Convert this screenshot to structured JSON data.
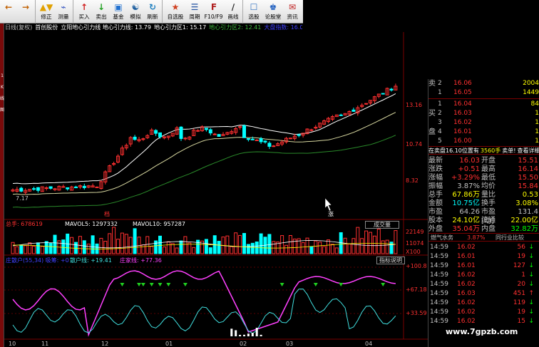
{
  "toolbar": {
    "buttons": [
      {
        "name": "back",
        "label": "",
        "icon": "←",
        "color": "#c06000"
      },
      {
        "name": "forward",
        "label": "",
        "icon": "→",
        "color": "#c06000"
      },
      {
        "name": "modify",
        "label": "修正",
        "icon": "▲▼",
        "color": "#e0a000"
      },
      {
        "name": "measure",
        "label": "测量",
        "icon": "⌁",
        "color": "#3050c0"
      },
      {
        "name": "buy",
        "label": "买入",
        "icon": "↑",
        "color": "#d02020"
      },
      {
        "name": "sell",
        "label": "卖出",
        "icon": "↓",
        "color": "#20a020"
      },
      {
        "name": "fund",
        "label": "基金",
        "icon": "▣",
        "color": "#2070d0"
      },
      {
        "name": "simulate",
        "label": "模拟",
        "icon": "☯",
        "color": "#2060a0"
      },
      {
        "name": "refresh",
        "label": "刷新",
        "icon": "↻",
        "color": "#2080c0"
      },
      {
        "name": "watchlist",
        "label": "自选股",
        "icon": "★",
        "color": "#d04020"
      },
      {
        "name": "periodic",
        "label": "周期",
        "icon": "☰",
        "color": "#2050a0"
      },
      {
        "name": "f10",
        "label": "F10/F9",
        "icon": "F",
        "color": "#b02020"
      },
      {
        "name": "draw",
        "label": "画线",
        "icon": "∕",
        "color": "#303030"
      },
      {
        "name": "select",
        "label": "选股",
        "icon": "☐",
        "color": "#3070c0"
      },
      {
        "name": "forum",
        "label": "论股堂",
        "icon": "♚",
        "color": "#2060c0"
      },
      {
        "name": "info",
        "label": "资讯",
        "icon": "✉",
        "color": "#c02020"
      }
    ]
  },
  "leftbar": {
    "labels": [
      "1",
      "K",
      "线",
      "图"
    ]
  },
  "infobar": {
    "items": [
      {
        "text": "日线(复权)",
        "color": "#c0c0c0"
      },
      {
        "text": "首创股份",
        "color": "#ffffff"
      },
      {
        "text": "立阳地心引力线 地心引力线: 13.79",
        "color": "#ffffff"
      },
      {
        "text": "地心引力区1: 15.17",
        "color": "#ffffff"
      },
      {
        "text": "地心引力区2: 12.41",
        "color": "#3db83d"
      },
      {
        "text": "大盘指数: 16.03",
        "color": "#4040ff"
      }
    ]
  },
  "chart": {
    "price_labels": [
      "13.16",
      "10.74",
      "8.32"
    ],
    "low_label": "7.17",
    "mark_labels": [
      "档",
      "涨"
    ],
    "volume_header": {
      "main": "总手: 678619",
      "ma5": "MAVOL5: 1297332",
      "ma10": "MAVOL10: 957287"
    },
    "volume_button": "成交量",
    "volume_scale": [
      "22149",
      "11074",
      "X100"
    ],
    "indicator_header": {
      "a": "庄散户(55,34)  吸筹: +0",
      "b": "散户线: +19.41",
      "c": "庄家线: +77.36"
    },
    "indicator_button": "指标说明",
    "indicator_scale": [
      "+100.8",
      "+67.18",
      "+33.59"
    ],
    "months": [
      "10",
      "11",
      "12",
      "01",
      "02",
      "03",
      "04"
    ]
  },
  "orderbook": {
    "sell": [
      {
        "side": "卖",
        "lv": "2",
        "price": "16.06",
        "vol": "2004"
      },
      {
        "side": "",
        "lv": "1",
        "price": "16.05",
        "vol": "1449"
      }
    ],
    "buy": [
      {
        "side": "",
        "lv": "1",
        "price": "16.04",
        "vol": "84"
      },
      {
        "side": "买",
        "lv": "2",
        "price": "16.03",
        "vol": "1"
      },
      {
        "side": "",
        "lv": "3",
        "price": "16.02",
        "vol": "1"
      },
      {
        "side": "盘",
        "lv": "4",
        "price": "16.01",
        "vol": "1"
      },
      {
        "side": "",
        "lv": "5",
        "price": "16.00",
        "vol": "1"
      }
    ]
  },
  "alert": {
    "text": "在卖盘16.10位置有",
    "qty": "3560手",
    "action": "卖单!",
    "detail": "查看详细"
  },
  "quote": [
    {
      "k": "最新",
      "v": "16.03",
      "vc": "#ff3030",
      "k2": "开盘",
      "v2": "15.51",
      "v2c": "#ff3030"
    },
    {
      "k": "涨跌",
      "v": "+0.51",
      "vc": "#ff3030",
      "k2": "最高",
      "v2": "16.14",
      "v2c": "#ff3030"
    },
    {
      "k": "涨幅",
      "v": "+3.29%",
      "vc": "#ff3030",
      "k2": "最低",
      "v2": "15.50",
      "v2c": "#ff3030"
    },
    {
      "k": "振幅",
      "v": "3.87%",
      "vc": "#c0c0c0",
      "k2": "均价",
      "v2": "15.84",
      "v2c": "#ff3030"
    },
    {
      "k": "总手",
      "v": "67.86万",
      "vc": "#ffff00",
      "k2": "量比",
      "v2": "0.53",
      "v2c": "#ffff00"
    },
    {
      "k": "金额",
      "v": "10.75亿",
      "vc": "#00ffff",
      "k2": "换手",
      "v2": "3.08%",
      "v2c": "#ffff00"
    },
    {
      "k": "市盈",
      "v": "64.26",
      "vc": "#c0c0c0",
      "k2": "市盈[动]",
      "v2": "131.4",
      "v2c": "#c0c0c0"
    },
    {
      "k": "股本",
      "v": "24.10亿",
      "vc": "#ffff00",
      "k2": "流通",
      "v2": "22.00亿",
      "v2c": "#ffff00"
    },
    {
      "k": "外盘",
      "v": "35.04万",
      "vc": "#ff3030",
      "k2": "内盘",
      "v2": "32.82万",
      "v2c": "#00ff00"
    }
  ],
  "tabs": {
    "left": "燃气水务",
    "pct": "3.87%",
    "right": "同行业比较"
  },
  "trades": [
    {
      "t": "14:59",
      "p": "16.02",
      "q": "56",
      "a": "↓",
      "ac": "#00ff00"
    },
    {
      "t": "14:59",
      "p": "16.01",
      "q": "19",
      "a": "↓",
      "ac": "#00ff00"
    },
    {
      "t": "14:59",
      "p": "16.01",
      "q": "127",
      "a": "↓",
      "ac": "#00ff00"
    },
    {
      "t": "14:59",
      "p": "16.02",
      "q": "1",
      "a": "↓",
      "ac": "#00ff00"
    },
    {
      "t": "14:59",
      "p": "16.02",
      "q": "20",
      "a": "↓",
      "ac": "#00ff00"
    },
    {
      "t": "14:59",
      "p": "16.03",
      "q": "451",
      "a": "↑",
      "ac": "#ff3030"
    },
    {
      "t": "14:59",
      "p": "16.02",
      "q": "119",
      "a": "↓",
      "ac": "#00ff00"
    },
    {
      "t": "14:59",
      "p": "16.02",
      "q": "19",
      "a": "↓",
      "ac": "#00ff00"
    },
    {
      "t": "14:59",
      "p": "16.02",
      "q": "15",
      "a": "↓",
      "ac": "#00ff00"
    }
  ],
  "watermark": "www.7gpzb.com",
  "colors": {
    "up": "#ff3030",
    "down": "#00ffff",
    "ma1": "#ffffff",
    "ma2": "#d8d8a0",
    "ma3": "#2a8a2a",
    "retail": "#ff40ff",
    "banker": "#40e0e0",
    "signal": "#20d020"
  }
}
